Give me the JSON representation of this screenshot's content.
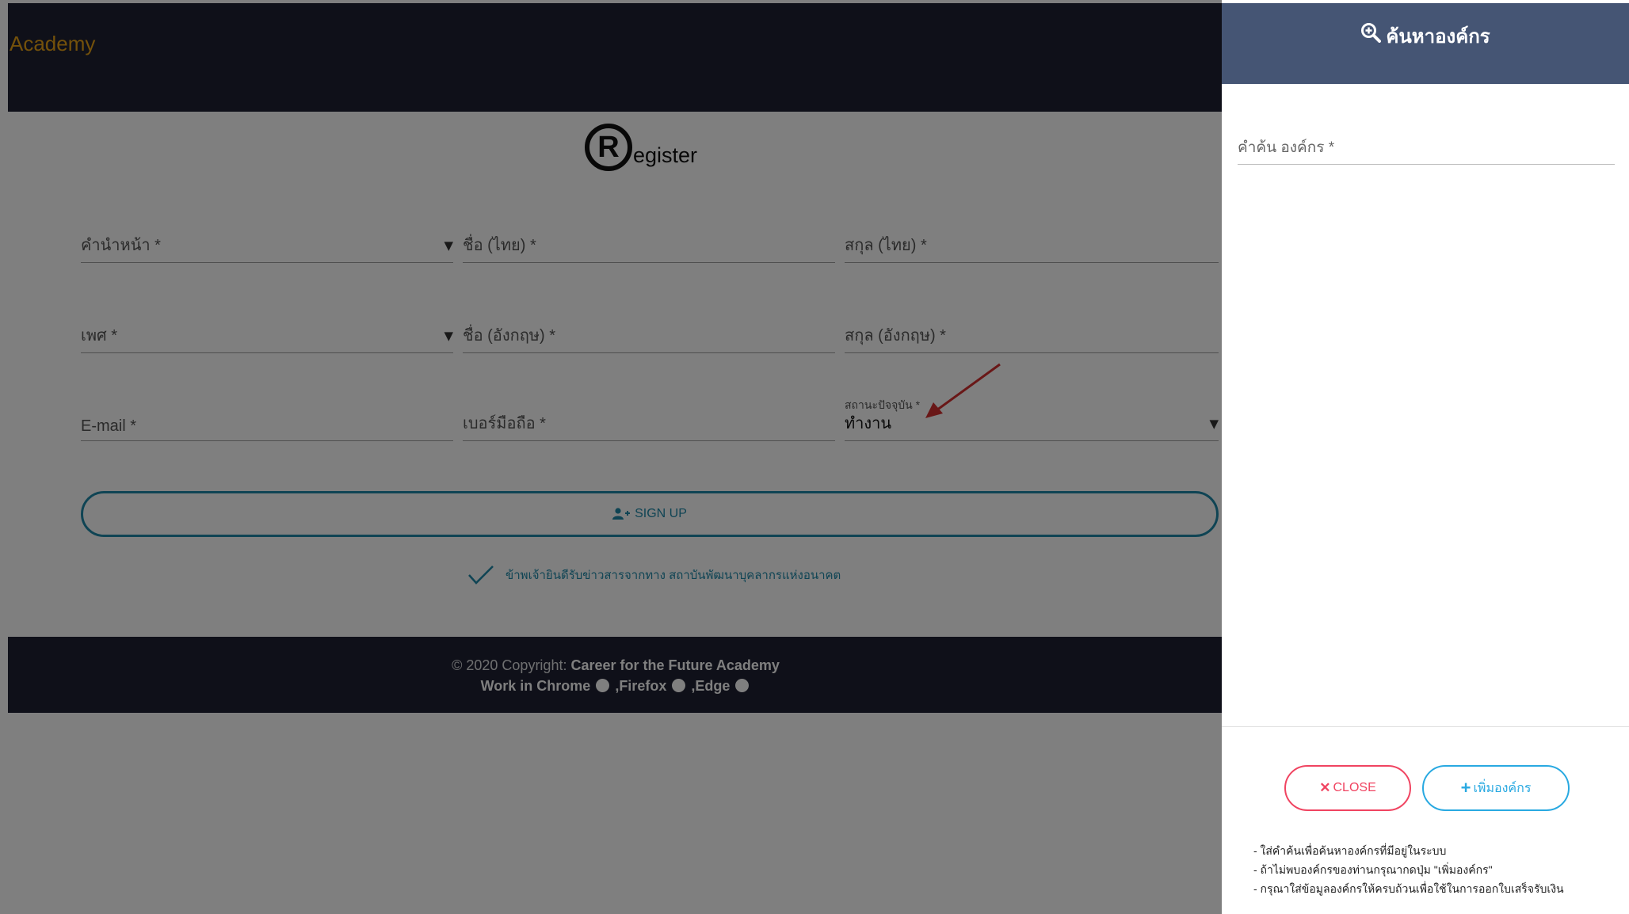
{
  "navbar": {
    "brand": "Academy"
  },
  "register": {
    "logo_letter": "R",
    "title_suffix": "egister"
  },
  "form": {
    "title_prefix": "คำนำหน้า *",
    "first_name_th": "ชื่อ (ไทย) *",
    "last_name_th": "สกุล (ไทย) *",
    "gender": "เพศ *",
    "first_name_en": "ชื่อ (อังกฤษ) *",
    "last_name_en": "สกุล (อังกฤษ) *",
    "email": "E-mail *",
    "mobile": "เบอร์มือถือ *",
    "status_label": "สถานะปัจจุบัน *",
    "status_value": "ทำงาน",
    "signup_label": "SIGN UP",
    "consent_text": "ข้าพเจ้ายินดีรับข่าวสารจากทาง สถาบันพัฒนาบุคลากรแห่งอนาคต"
  },
  "footer": {
    "copyright_prefix": "© 2020 Copyright: ",
    "copyright_name": "Career for the Future Academy",
    "browsers_prefix": "Work in Chrome",
    "firefox": " ,Firefox",
    "edge": " ,Edge"
  },
  "drawer": {
    "title": "ค้นหาองค์กร",
    "search_label": "คำค้น องค์กร *",
    "close_label": "CLOSE",
    "add_label": "เพิ่มองค์กร",
    "notes": [
      "- ใส่คำค้นเพื่อค้นหาองค์กรที่มีอยู่ในระบบ",
      "- ถ้าไม่พบองค์กรของท่านกรุณากดปุ่ม \"เพิ่มองค์กร\"",
      "- กรุณาใส่ข้อมูลองค์กรให้ครบถ้วนเพื่อใช้ในการออกใบเสร็จรับเงิน"
    ]
  },
  "colors": {
    "navbar_bg": "#1e2132",
    "brand": "#e8a317",
    "accent": "#1e88a8",
    "drawer_header": "#455574",
    "close": "#f04461",
    "add": "#29a9e1",
    "annotation_arrow": "#d32f2f"
  },
  "icons": {
    "signup": "user-plus-icon",
    "consent": "check-icon",
    "drawer_title": "search-plus-icon",
    "close": "x-icon",
    "add": "plus-icon",
    "browsers": [
      "chrome-icon",
      "firefox-icon",
      "edge-icon"
    ],
    "annotation": "red-arrow-icon"
  }
}
